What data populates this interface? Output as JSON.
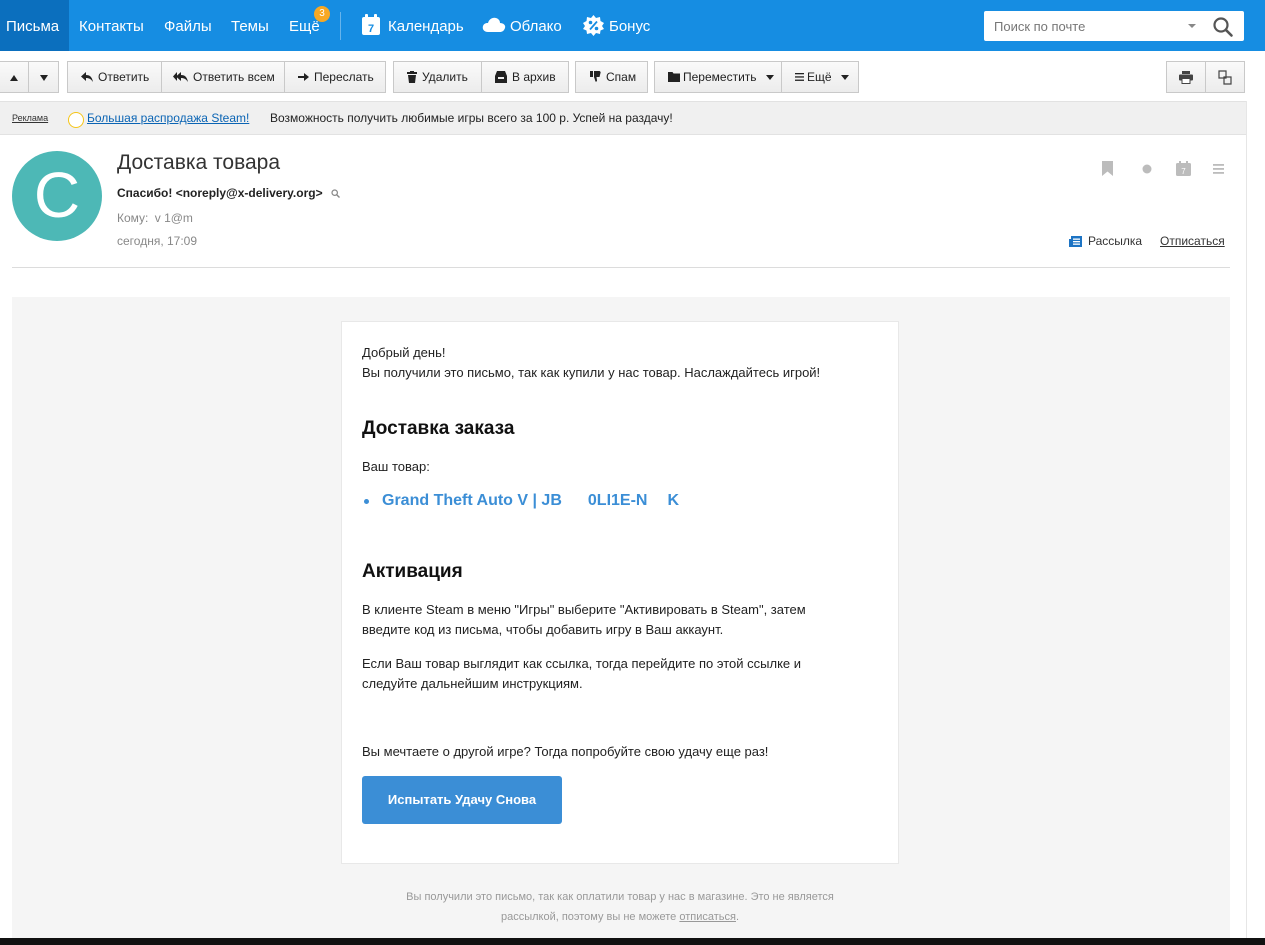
{
  "nav": {
    "items": [
      "Письма",
      "Контакты",
      "Файлы",
      "Темы",
      "Ещё"
    ],
    "more_badge": "3",
    "calendar": "Календарь",
    "calendar_day": "7",
    "cloud": "Облако",
    "bonus": "Бонус",
    "search_placeholder": "Поиск по почте"
  },
  "toolbar": {
    "reply": "Ответить",
    "reply_all": "Ответить всем",
    "forward": "Переслать",
    "delete": "Удалить",
    "archive": "В архив",
    "spam": "Спам",
    "move": "Переместить",
    "more": "Ещё"
  },
  "ad": {
    "label": "Реклама",
    "link": "Большая распродажа Steam!",
    "text": "Возможность получить любимые игры всего за 100 р. Успей на раздачу!"
  },
  "message": {
    "avatar_letter": "С",
    "subject": "Доставка товара",
    "from": "Спасибо! <noreply@x-delivery.org>",
    "to_label": "Кому:",
    "to_value": "v        1@m",
    "date": "сегодня, 17:09",
    "newsletter": "Рассылка",
    "unsubscribe": "Отписаться",
    "calendar_day": "7"
  },
  "body": {
    "greeting": "Добрый день!",
    "intro": "Вы получили это письмо, так как купили у нас товар. Наслаждайтесь игрой!",
    "delivery_heading": "Доставка заказа",
    "your_item": "Ваш товар:",
    "product": "Grand Theft Auto V | JB",
    "product_tail": "0LI1E-N",
    "product_end": "K",
    "activation_heading": "Активация",
    "activation_p1_l1": "В клиенте Steam в меню \"Игры\" выберите \"Активировать в Steam\", затем",
    "activation_p1_l2": "введите код из письма, чтобы добавить игру в Ваш аккаунт.",
    "activation_p2_l1": "Если Ваш товар выглядит как ссылка, тогда перейдите по этой ссылке и",
    "activation_p2_l2": "следуйте дальнейшим инструкциям.",
    "dream": "Вы мечтаете о другой игре? Тогда попробуйте свою удачу еще раз!",
    "cta": "Испытать Удачу Снова",
    "footer_l1": "Вы получили это письмо, так как оплатили товар у нас в магазине. Это не является",
    "footer_l2_a": "рассылкой, поэтому вы не можете ",
    "footer_l2_link": "отписаться",
    "footer_l2_end": "."
  },
  "colors": {
    "topbar": "#168de2",
    "active_tab": "#0b6fbe",
    "badge": "#f7a823",
    "avatar": "#4db8b6",
    "link": "#3b8ed6"
  }
}
